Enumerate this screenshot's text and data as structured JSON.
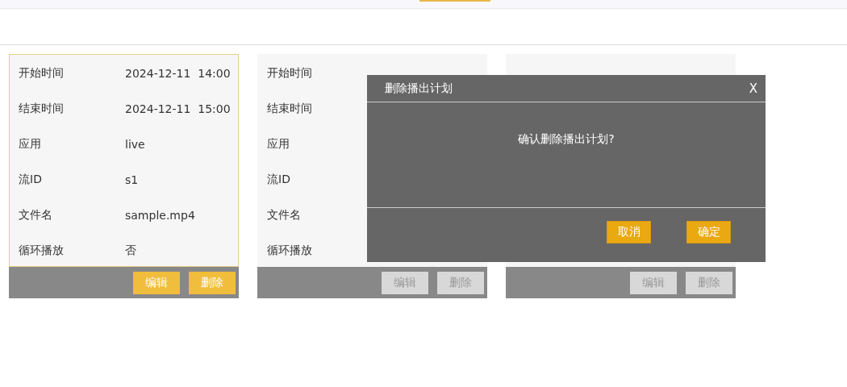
{
  "cards": [
    {
      "selected": true,
      "fields": [
        {
          "label": "开始时间",
          "value": "2024-12-11  14:00"
        },
        {
          "label": "结束时间",
          "value": "2024-12-11  15:00"
        },
        {
          "label": "应用",
          "value": "live"
        },
        {
          "label": "流ID",
          "value": "s1"
        },
        {
          "label": "文件名",
          "value": "sample.mp4"
        },
        {
          "label": "循环播放",
          "value": "否"
        }
      ],
      "buttons": [
        {
          "label": "编辑",
          "disabled": false
        },
        {
          "label": "删除",
          "disabled": false
        }
      ]
    },
    {
      "selected": false,
      "fields": [
        {
          "label": "开始时间"
        },
        {
          "label": "结束时间"
        },
        {
          "label": "应用"
        },
        {
          "label": "流ID"
        },
        {
          "label": "文件名"
        },
        {
          "label": "循环播放"
        }
      ],
      "buttons": [
        {
          "label": "编辑",
          "disabled": true
        },
        {
          "label": "删除",
          "disabled": true
        }
      ]
    },
    {
      "selected": false,
      "buttons": [
        {
          "label": "编辑",
          "disabled": true
        },
        {
          "label": "删除",
          "disabled": true
        }
      ]
    }
  ],
  "dialog": {
    "title": "删除播出计划",
    "close": "X",
    "message": "确认删除播出计划?",
    "buttons": [
      "取消",
      "确定"
    ]
  }
}
